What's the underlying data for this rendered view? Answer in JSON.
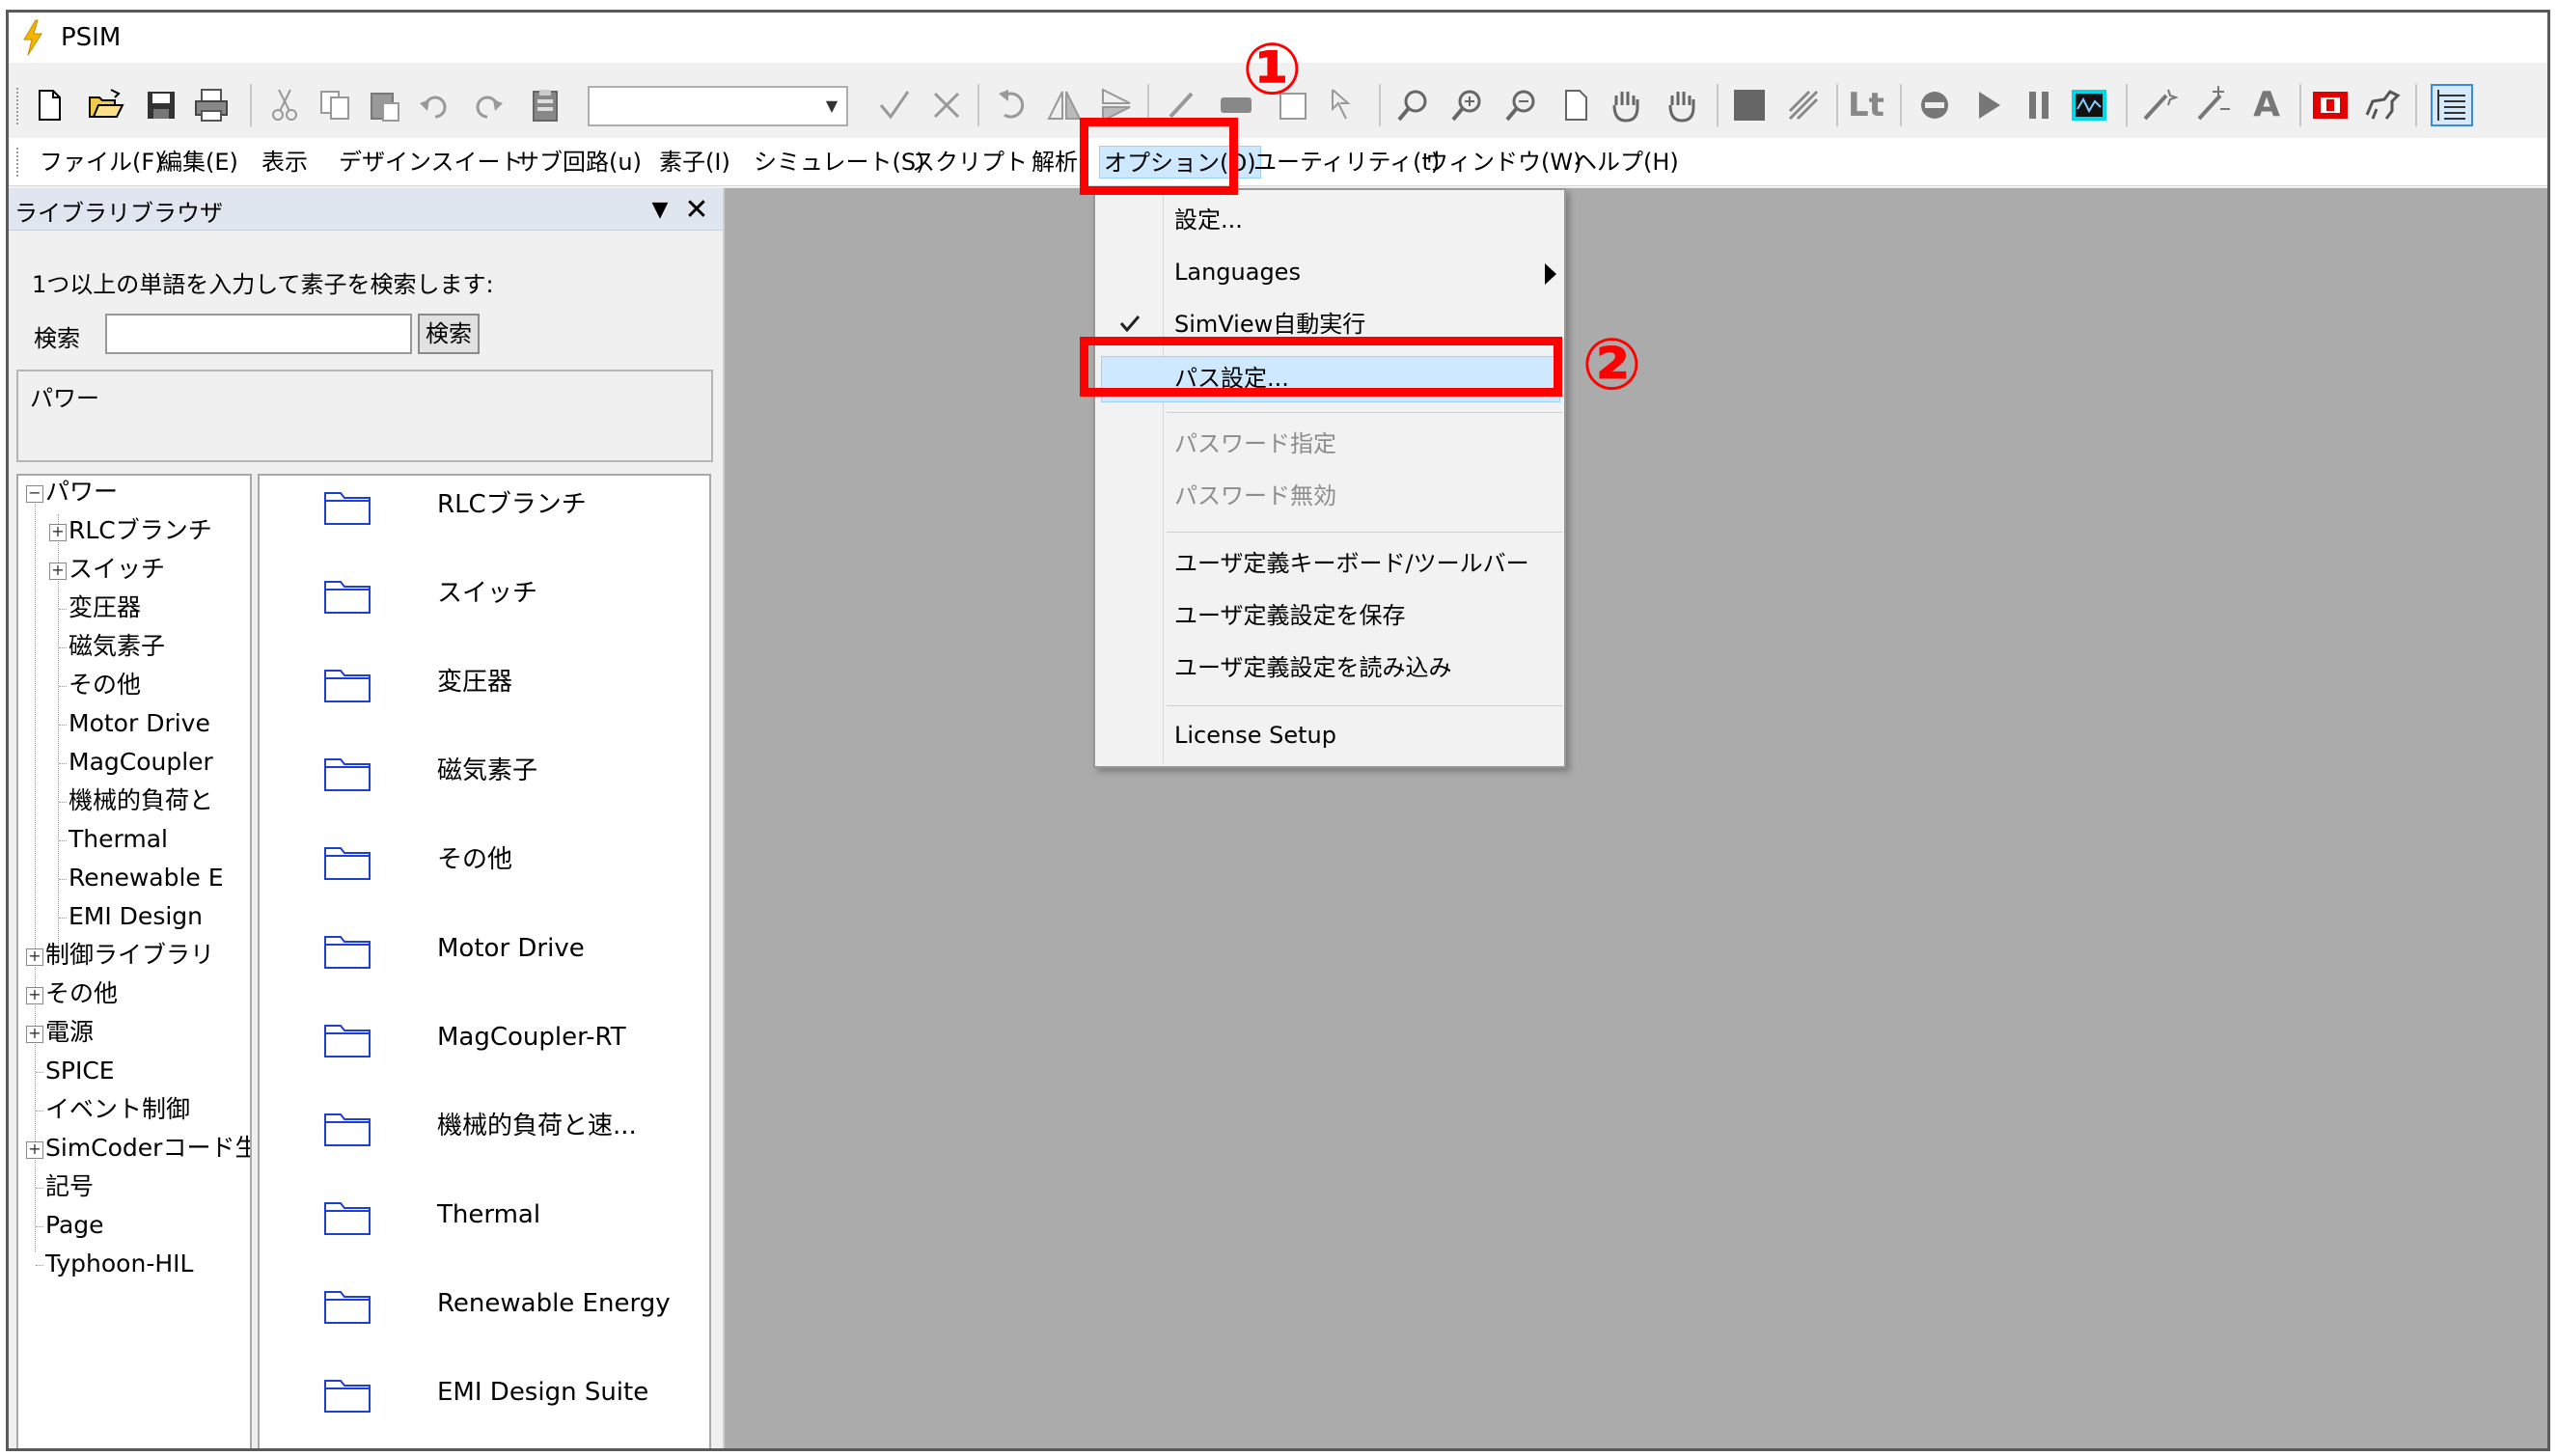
{
  "window": {
    "title": "PSIM"
  },
  "toolbar": {
    "icons": [
      "new-file-icon",
      "open-folder-icon",
      "save-icon",
      "print-icon",
      "cut-icon",
      "copy-icon",
      "paste-icon",
      "undo-icon",
      "redo-icon",
      "clipboard-icon",
      "combo",
      "check-icon",
      "x-icon",
      "rotate-icon",
      "flip-h-icon",
      "flip-v-icon",
      "pencil-icon",
      "eraser-icon",
      "label-icon",
      "select-arrow-icon",
      "zoom-icon",
      "zoom-in-icon",
      "zoom-out-icon",
      "page-icon",
      "pan-hand-icon",
      "pan-hand-icon-2",
      "block-icon",
      "probe-icon",
      "lt-text",
      "stop-icon",
      "play-icon",
      "pause-icon",
      "scope-icon",
      "wand-icon",
      "param-icon",
      "text-a",
      "flag-icon",
      "horse-icon",
      "tree-view-icon"
    ],
    "lt_label": "Lt",
    "a_label": "A"
  },
  "menubar": {
    "items": [
      "ファイル(F)",
      "編集(E)",
      "表示",
      "デザインスイート",
      "サブ回路(u)",
      "素子(I)",
      "シミュレート(S)",
      "スクリプト",
      "解析",
      "オプション(O)",
      "ユーティリティ(t)",
      "ウィンドウ(W)",
      "ヘルプ(H)"
    ]
  },
  "library": {
    "title": "ライブラリブラウザ",
    "search_hint": "1つ以上の単語を入力して素子を検索します:",
    "search_label": "検索",
    "search_button": "検索",
    "search_value": "",
    "result_text": "パワー",
    "tree": [
      {
        "label": "パワー",
        "level": 0,
        "expander": "⊟"
      },
      {
        "label": "RLCブランチ",
        "level": 1,
        "expander": "⊞"
      },
      {
        "label": "スイッチ",
        "level": 1,
        "expander": "⊞"
      },
      {
        "label": "変圧器",
        "level": 1,
        "expander": ""
      },
      {
        "label": "磁気素子",
        "level": 1,
        "expander": ""
      },
      {
        "label": "その他",
        "level": 1,
        "expander": ""
      },
      {
        "label": "Motor Drive",
        "level": 1,
        "expander": ""
      },
      {
        "label": "MagCoupler",
        "level": 1,
        "expander": ""
      },
      {
        "label": "機械的負荷と",
        "level": 1,
        "expander": ""
      },
      {
        "label": "Thermal",
        "level": 1,
        "expander": ""
      },
      {
        "label": "Renewable E",
        "level": 1,
        "expander": ""
      },
      {
        "label": "EMI Design",
        "level": 1,
        "expander": ""
      },
      {
        "label": "制御ライブラリ",
        "level": 0,
        "expander": "⊞"
      },
      {
        "label": "その他",
        "level": 0,
        "expander": "⊞"
      },
      {
        "label": "電源",
        "level": 0,
        "expander": "⊞"
      },
      {
        "label": "SPICE",
        "level": 0,
        "expander": ""
      },
      {
        "label": "イベント制御",
        "level": 0,
        "expander": ""
      },
      {
        "label": "SimCoderコード生",
        "level": 0,
        "expander": "⊞"
      },
      {
        "label": "記号",
        "level": 0,
        "expander": ""
      },
      {
        "label": "Page",
        "level": 0,
        "expander": ""
      },
      {
        "label": "Typhoon-HIL",
        "level": 0,
        "expander": ""
      }
    ],
    "folders": [
      "RLCブランチ",
      "スイッチ",
      "変圧器",
      "磁気素子",
      "その他",
      "Motor Drive",
      "MagCoupler-RT",
      "機械的負荷と速...",
      "Thermal",
      "Renewable Energy",
      "EMI Design Suite"
    ]
  },
  "options_menu": {
    "items": [
      {
        "label": "設定...",
        "disabled": false
      },
      {
        "label": "Languages",
        "disabled": false,
        "submenu": true
      },
      {
        "label": "SimView自動実行",
        "disabled": false,
        "checked": true
      },
      {
        "label": "パス設定...",
        "disabled": false,
        "highlighted": true
      },
      {
        "label": "パスワード指定",
        "disabled": true
      },
      {
        "label": "パスワード無効",
        "disabled": true
      },
      {
        "label": "ユーザ定義キーボード/ツールバー",
        "disabled": false
      },
      {
        "label": "ユーザ定義設定を保存",
        "disabled": false
      },
      {
        "label": "ユーザ定義設定を読み込み",
        "disabled": false
      },
      {
        "label": "License Setup",
        "disabled": false
      }
    ]
  },
  "annotations": {
    "step1": "①",
    "step2": "②",
    "color": "#ff0000"
  },
  "colors": {
    "canvas": "#ababab",
    "highlight": "#cde8ff",
    "folder": "#1f3fd1"
  }
}
